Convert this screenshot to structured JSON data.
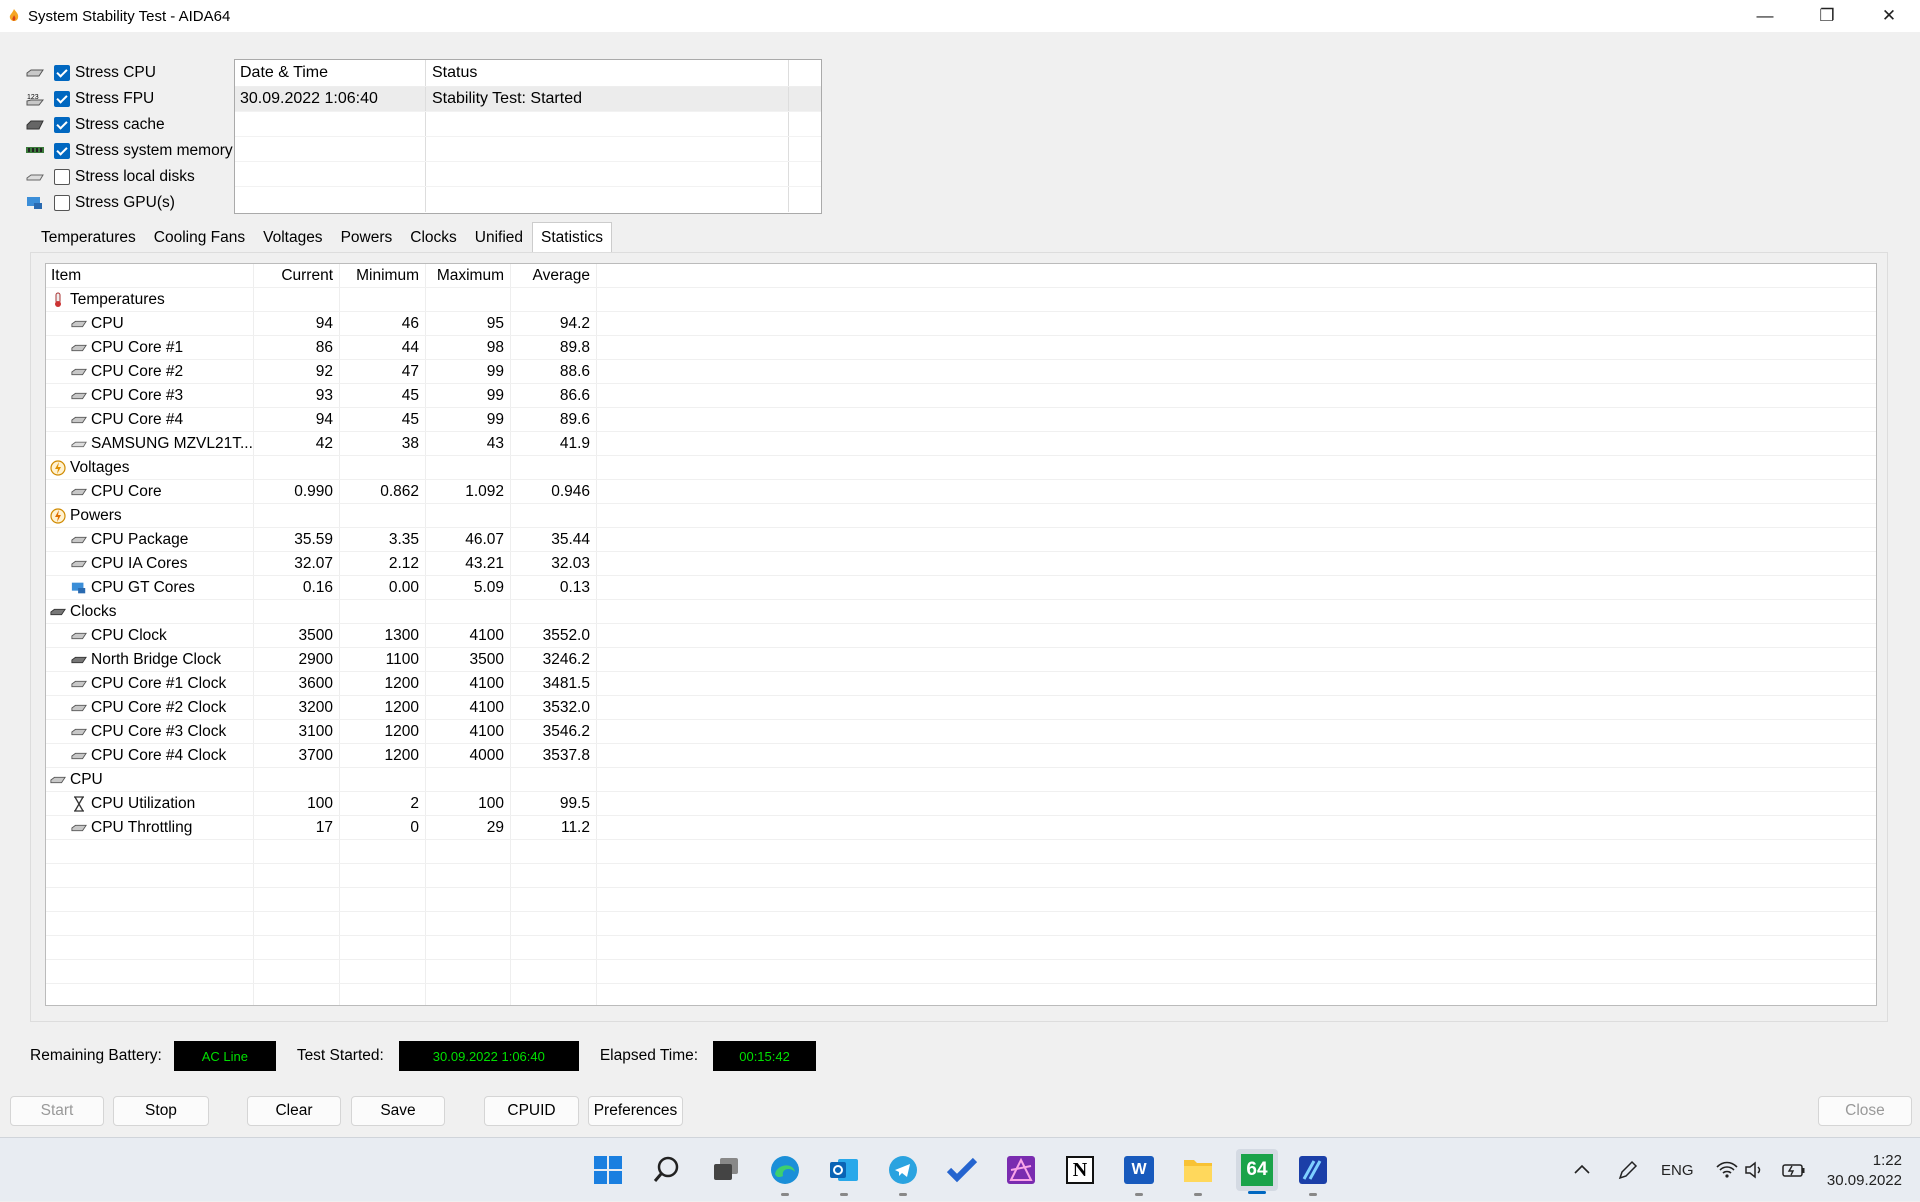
{
  "window": {
    "title": "System Stability Test - AIDA64",
    "controls": {
      "minimize": "—",
      "restore": "❐",
      "close": "✕"
    }
  },
  "stress_options": [
    {
      "label": "Stress CPU",
      "checked": true,
      "icon": "cpu-icon"
    },
    {
      "label": "Stress FPU",
      "checked": true,
      "icon": "fpu-icon"
    },
    {
      "label": "Stress cache",
      "checked": true,
      "icon": "cache-icon"
    },
    {
      "label": "Stress system memory",
      "checked": true,
      "icon": "memory-icon"
    },
    {
      "label": "Stress local disks",
      "checked": false,
      "icon": "disk-icon"
    },
    {
      "label": "Stress GPU(s)",
      "checked": false,
      "icon": "gpu-icon"
    }
  ],
  "log": {
    "headers": {
      "datetime": "Date & Time",
      "status": "Status"
    },
    "rows": [
      {
        "datetime": "30.09.2022 1:06:40",
        "status": "Stability Test: Started"
      }
    ]
  },
  "tabs": [
    {
      "label": "Temperatures",
      "active": false
    },
    {
      "label": "Cooling Fans",
      "active": false
    },
    {
      "label": "Voltages",
      "active": false
    },
    {
      "label": "Powers",
      "active": false
    },
    {
      "label": "Clocks",
      "active": false
    },
    {
      "label": "Unified",
      "active": false
    },
    {
      "label": "Statistics",
      "active": true
    }
  ],
  "stats": {
    "headers": {
      "item": "Item",
      "current": "Current",
      "minimum": "Minimum",
      "maximum": "Maximum",
      "average": "Average"
    },
    "rows": [
      {
        "group": true,
        "item": "Temperatures",
        "icon": "thermometer-icon"
      },
      {
        "item": "CPU",
        "icon": "cpu-icon",
        "current": "94",
        "minimum": "46",
        "maximum": "95",
        "average": "94.2"
      },
      {
        "item": "CPU Core #1",
        "icon": "cpu-icon",
        "current": "86",
        "minimum": "44",
        "maximum": "98",
        "average": "89.8"
      },
      {
        "item": "CPU Core #2",
        "icon": "cpu-icon",
        "current": "92",
        "minimum": "47",
        "maximum": "99",
        "average": "88.6"
      },
      {
        "item": "CPU Core #3",
        "icon": "cpu-icon",
        "current": "93",
        "minimum": "45",
        "maximum": "99",
        "average": "86.6"
      },
      {
        "item": "CPU Core #4",
        "icon": "cpu-icon",
        "current": "94",
        "minimum": "45",
        "maximum": "99",
        "average": "89.6"
      },
      {
        "item": "SAMSUNG MZVL21T...",
        "icon": "disk-icon",
        "current": "42",
        "minimum": "38",
        "maximum": "43",
        "average": "41.9"
      },
      {
        "group": true,
        "item": "Voltages",
        "icon": "voltage-icon"
      },
      {
        "item": "CPU Core",
        "icon": "cpu-icon",
        "current": "0.990",
        "minimum": "0.862",
        "maximum": "1.092",
        "average": "0.946"
      },
      {
        "group": true,
        "item": "Powers",
        "icon": "power-icon"
      },
      {
        "item": "CPU Package",
        "icon": "cpu-icon",
        "current": "35.59",
        "minimum": "3.35",
        "maximum": "46.07",
        "average": "35.44"
      },
      {
        "item": "CPU IA Cores",
        "icon": "cpu-icon",
        "current": "32.07",
        "minimum": "2.12",
        "maximum": "43.21",
        "average": "32.03"
      },
      {
        "item": "CPU GT Cores",
        "icon": "gpu-icon",
        "current": "0.16",
        "minimum": "0.00",
        "maximum": "5.09",
        "average": "0.13"
      },
      {
        "group": true,
        "item": "Clocks",
        "icon": "clock-chip-icon"
      },
      {
        "item": "CPU Clock",
        "icon": "cpu-icon",
        "current": "3500",
        "minimum": "1300",
        "maximum": "4100",
        "average": "3552.0"
      },
      {
        "item": "North Bridge Clock",
        "icon": "chip-icon",
        "current": "2900",
        "minimum": "1100",
        "maximum": "3500",
        "average": "3246.2"
      },
      {
        "item": "CPU Core #1 Clock",
        "icon": "cpu-icon",
        "current": "3600",
        "minimum": "1200",
        "maximum": "4100",
        "average": "3481.5"
      },
      {
        "item": "CPU Core #2 Clock",
        "icon": "cpu-icon",
        "current": "3200",
        "minimum": "1200",
        "maximum": "4100",
        "average": "3532.0"
      },
      {
        "item": "CPU Core #3 Clock",
        "icon": "cpu-icon",
        "current": "3100",
        "minimum": "1200",
        "maximum": "4100",
        "average": "3546.2"
      },
      {
        "item": "CPU Core #4 Clock",
        "icon": "cpu-icon",
        "current": "3700",
        "minimum": "1200",
        "maximum": "4000",
        "average": "3537.8"
      },
      {
        "group": true,
        "item": "CPU",
        "icon": "cpu-icon"
      },
      {
        "item": "CPU Utilization",
        "icon": "hourglass-icon",
        "current": "100",
        "minimum": "2",
        "maximum": "100",
        "average": "99.5"
      },
      {
        "item": "CPU Throttling",
        "icon": "cpu-icon",
        "current": "17",
        "minimum": "0",
        "maximum": "29",
        "average": "11.2"
      }
    ]
  },
  "status": {
    "battery_label": "Remaining Battery:",
    "battery_value": "AC Line",
    "started_label": "Test Started:",
    "started_value": "30.09.2022 1:06:40",
    "elapsed_label": "Elapsed Time:",
    "elapsed_value": "00:15:42",
    "lcd_color": "#00e000"
  },
  "buttons": {
    "start": "Start",
    "stop": "Stop",
    "clear": "Clear",
    "save": "Save",
    "cpuid": "CPUID",
    "preferences": "Preferences",
    "close": "Close"
  },
  "taskbar": {
    "apps": [
      "windows-start-icon",
      "search-icon",
      "task-view-icon",
      "edge-icon",
      "outlook-icon",
      "telegram-icon",
      "todo-icon",
      "affinity-photo-icon",
      "notion-icon",
      "word-icon",
      "file-explorer-icon",
      "aida64-icon",
      "affinity-designer-icon"
    ],
    "aida_label": "64",
    "notion_label": "N",
    "word_label": "W",
    "lang": "ENG",
    "time": "1:22",
    "date": "30.09.2022"
  }
}
